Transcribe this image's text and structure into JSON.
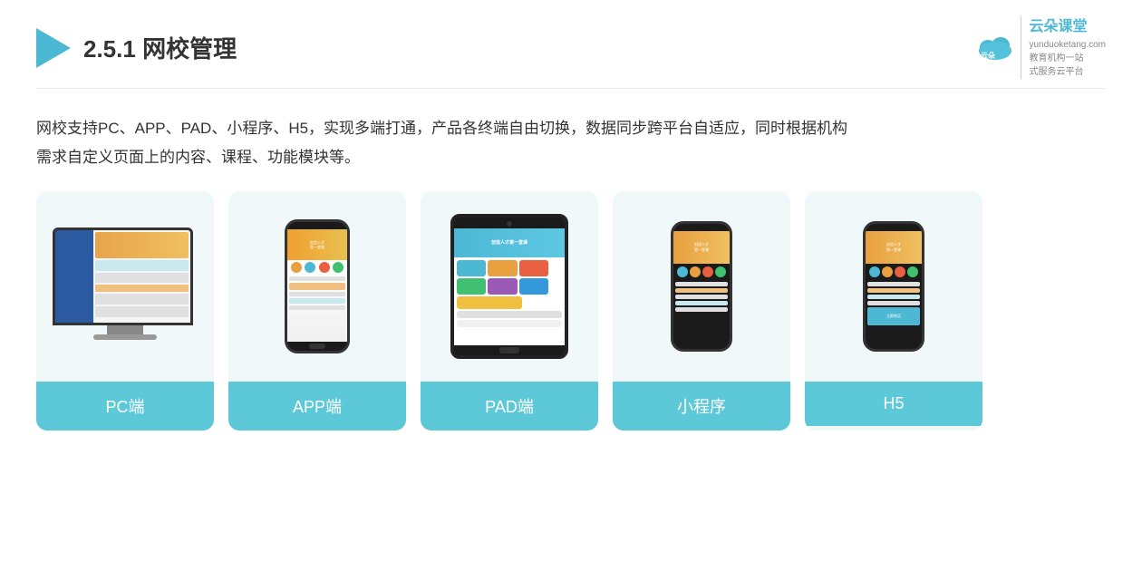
{
  "header": {
    "section_number": "2.5.1",
    "title_normal": "",
    "title_bold": "网校管理",
    "logo_brand": "云朵课堂",
    "logo_url_text": "yunduoketang.com",
    "logo_tagline_1": "教育机构一站",
    "logo_tagline_2": "式服务云平台"
  },
  "description": {
    "line1": "网校支持PC、APP、PAD、小程序、H5，实现多端打通，产品各终端自由切换，数据同步跨平台自适应，同时根据机构",
    "line2": "需求自定义页面上的内容、课程、功能模块等。"
  },
  "cards": [
    {
      "id": "pc",
      "label": "PC端"
    },
    {
      "id": "app",
      "label": "APP端"
    },
    {
      "id": "pad",
      "label": "PAD端"
    },
    {
      "id": "miniprogram",
      "label": "小程序"
    },
    {
      "id": "h5",
      "label": "H5"
    }
  ]
}
